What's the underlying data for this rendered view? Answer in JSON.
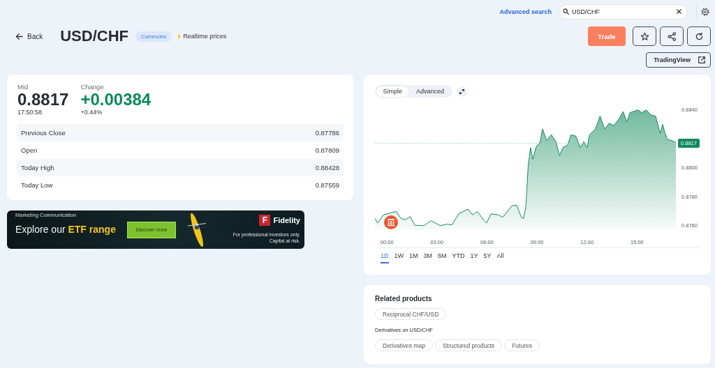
{
  "header": {
    "advanced_search": "Advanced search",
    "search": {
      "value": "USD/CHF"
    }
  },
  "title_bar": {
    "back": "Back",
    "symbol": "USD/CHF",
    "category_badge": "Currencies",
    "realtime_label": "Realtime prices"
  },
  "actions": {
    "trade": "Trade",
    "tradingview": "TradingView"
  },
  "quote": {
    "mid_label": "Mid",
    "mid": "0.8817",
    "time": "17:50:58",
    "change_label": "Change",
    "change": "+0.00384",
    "change_percent": "+0.44%"
  },
  "stats": [
    {
      "label": "Previous Close",
      "value": "0.87786"
    },
    {
      "label": "Open",
      "value": "0.87809"
    },
    {
      "label": "Today High",
      "value": "0.88428"
    },
    {
      "label": "Today Low",
      "value": "0.87559"
    }
  ],
  "ad": {
    "tagline": "Marketing Communication",
    "headline": "Explore our **ETF range**",
    "button": "Discover more",
    "brand_mark": "F",
    "brand": "Fidelity",
    "disclaimer": [
      "For professional investors only.",
      "Capital at risk."
    ]
  },
  "chart": {
    "modes": [
      {
        "label": "Simple",
        "selected": true
      },
      {
        "label": "Advanced",
        "selected": false
      }
    ],
    "chart_data": {
      "type": "area",
      "x": [
        -0.72,
        -0.56,
        -0.21,
        0.56,
        0.83,
        1.1,
        1.39,
        1.67,
        2.22,
        2.64,
        3.19,
        3.61,
        3.89,
        4.31,
        4.86,
        5.14,
        5.42,
        5.83,
        5.97,
        6.25,
        6.67,
        6.94,
        7.5,
        7.78,
        8.06,
        8.19,
        8.33,
        8.47,
        8.61,
        8.75,
        8.96,
        9.17,
        9.33,
        9.58,
        9.86,
        10.14,
        10.35,
        10.56,
        10.83,
        11.04,
        11.32,
        11.6,
        11.81,
        12.01,
        12.15,
        12.5,
        12.78,
        13.06,
        13.33,
        13.61,
        13.89,
        14.17,
        14.38,
        14.58,
        15.07,
        15.28,
        15.56,
        15.83,
        16.11,
        16.39,
        16.53,
        16.67,
        16.81,
        17.08,
        17.33
      ],
      "series": [
        {
          "color": "#138a5e",
          "values": [
            0.8765,
            0.87618,
            0.87674,
            0.87698,
            0.8765,
            0.8764,
            0.87662,
            0.87602,
            0.876,
            0.87634,
            0.876,
            0.8761,
            0.87605,
            0.87682,
            0.87714,
            0.87674,
            0.87698,
            0.87634,
            0.87618,
            0.87682,
            0.87674,
            0.87658,
            0.87738,
            0.87741,
            0.87658,
            0.8765,
            0.8773,
            0.88011,
            0.8814,
            0.88059,
            0.88148,
            0.88172,
            0.88268,
            0.88188,
            0.88228,
            0.8818,
            0.88084,
            0.8814,
            0.88156,
            0.88228,
            0.8822,
            0.8814,
            0.8818,
            0.8814,
            0.88228,
            0.88268,
            0.88357,
            0.88268,
            0.88308,
            0.88292,
            0.88333,
            0.88389,
            0.88316,
            0.88381,
            0.884,
            0.88381,
            0.884,
            0.88365,
            0.88357,
            0.88236,
            0.883,
            0.88244,
            0.88196,
            0.88188,
            0.88175
          ]
        }
      ],
      "xlim": [
        -0.72,
        17.33
      ],
      "ylim": [
        0.876,
        0.884
      ],
      "xticks": [
        {
          "value": 0,
          "label": "00:00"
        },
        {
          "value": 3,
          "label": "03:00"
        },
        {
          "value": 6,
          "label": "06:00"
        },
        {
          "value": 9,
          "label": "09:00"
        },
        {
          "value": 12,
          "label": "12:00"
        },
        {
          "value": 15,
          "label": "15:00"
        }
      ],
      "yticks": [
        {
          "value": 0.876,
          "label": "0.8760"
        },
        {
          "value": 0.878,
          "label": "0.8780"
        },
        {
          "value": 0.88,
          "label": "0.8800"
        },
        {
          "value": 0.884,
          "label": "0.8840"
        }
      ],
      "ref_lines": [
        {
          "axis": "y",
          "value": 0.8817,
          "label": "0.8817",
          "color": "#8cc7ad"
        }
      ]
    },
    "ranges": [
      {
        "label": "1D",
        "selected": true
      },
      {
        "label": "1W",
        "selected": false
      },
      {
        "label": "1M",
        "selected": false
      },
      {
        "label": "3M",
        "selected": false
      },
      {
        "label": "6M",
        "selected": false
      },
      {
        "label": "YTD",
        "selected": false
      },
      {
        "label": "1Y",
        "selected": false
      },
      {
        "label": "5Y",
        "selected": false
      },
      {
        "label": "All",
        "selected": false
      }
    ]
  },
  "related": {
    "title": "Related products",
    "items": [
      "Reciprocal CHF/USD"
    ],
    "derivatives_title": "Derivatives on USD/CHF",
    "derivatives": [
      "Derivatives map",
      "Structured products",
      "Futures"
    ]
  }
}
